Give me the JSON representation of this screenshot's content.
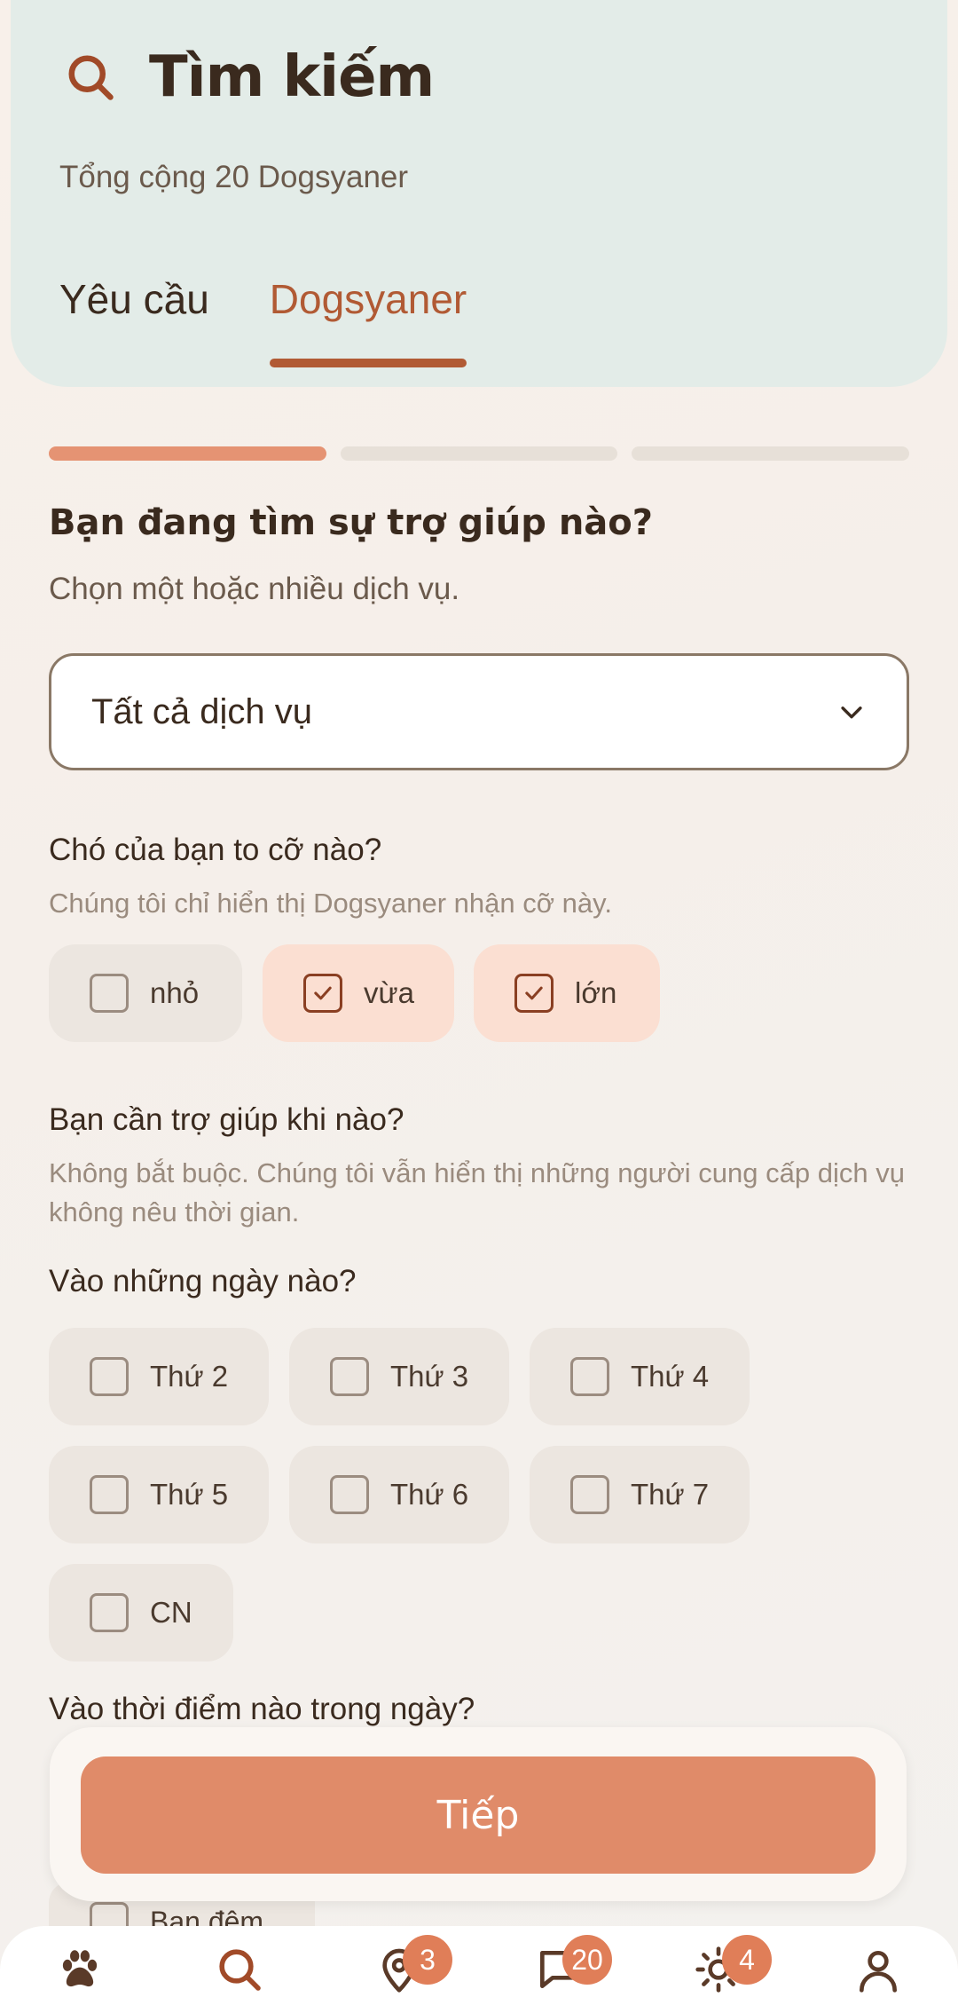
{
  "header": {
    "title": "Tìm kiếm",
    "subtitle": "Tổng cộng 20 Dogsyaner",
    "tabs": [
      {
        "label": "Yêu cầu",
        "active": false
      },
      {
        "label": "Dogsyaner",
        "active": true
      }
    ]
  },
  "progress": {
    "steps_total": 3,
    "steps_done": 1
  },
  "service": {
    "question": "Bạn đang tìm sự trợ giúp nào?",
    "hint": "Chọn một hoặc nhiều dịch vụ.",
    "selected": "Tất cả dịch vụ"
  },
  "size": {
    "question": "Chó của bạn to cỡ nào?",
    "hint": "Chúng tôi chỉ hiển thị Dogsyaner nhận cỡ này.",
    "options": [
      {
        "label": "nhỏ",
        "checked": false
      },
      {
        "label": "vừa",
        "checked": true
      },
      {
        "label": "lớn",
        "checked": true
      }
    ]
  },
  "when": {
    "question": "Bạn cần trợ giúp khi nào?",
    "hint": "Không bắt buộc. Chúng tôi vẫn hiển thị những người cung cấp dịch vụ không nêu thời gian.",
    "days_question": "Vào những ngày nào?",
    "days": [
      {
        "label": "Thứ 2",
        "checked": false
      },
      {
        "label": "Thứ 3",
        "checked": false
      },
      {
        "label": "Thứ 4",
        "checked": false
      },
      {
        "label": "Thứ 5",
        "checked": false
      },
      {
        "label": "Thứ 6",
        "checked": false
      },
      {
        "label": "Thứ 7",
        "checked": false
      },
      {
        "label": "CN",
        "checked": false
      }
    ],
    "time_question": "Vào thời điểm nào trong ngày?",
    "time_peek_option": "Ban đêm"
  },
  "cta": {
    "label": "Tiếp"
  },
  "nav": {
    "items": [
      {
        "icon": "paw-icon",
        "badge": ""
      },
      {
        "icon": "search-icon",
        "badge": ""
      },
      {
        "icon": "map-pin-icon",
        "badge": "3"
      },
      {
        "icon": "chat-icon",
        "badge": "20"
      },
      {
        "icon": "sun-icon",
        "badge": "4"
      },
      {
        "icon": "user-icon",
        "badge": ""
      }
    ]
  },
  "colors": {
    "accent": "#e08b69",
    "accent_dark": "#b15a34",
    "header_bg": "#e3ece8",
    "chip_checked_bg": "#fbdfd2",
    "chip_bg": "#ece6e0"
  }
}
